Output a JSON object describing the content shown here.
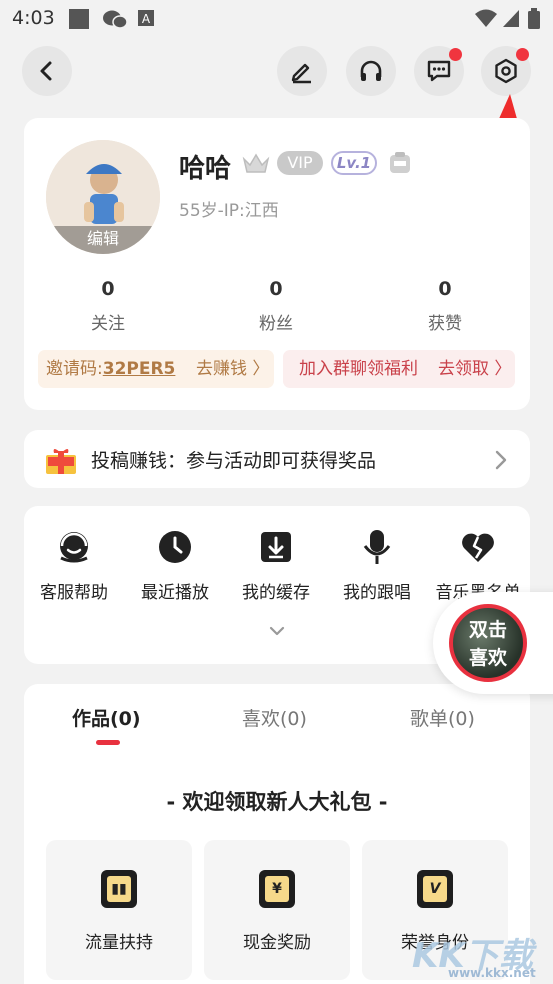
{
  "status_bar": {
    "time": "4:03"
  },
  "profile": {
    "username": "哈哈",
    "vip_label": "VIP",
    "level_label": "Lv.1",
    "avatar_edit_label": "编辑",
    "meta": "55岁-IP:江西",
    "stats": [
      {
        "value": "0",
        "label": "关注"
      },
      {
        "value": "0",
        "label": "粉丝"
      },
      {
        "value": "0",
        "label": "获赞"
      }
    ],
    "invite": {
      "prefix": "邀请码:",
      "code": "32PER5",
      "action": "去赚钱 〉"
    },
    "group": {
      "text": "加入群聊领福利",
      "action": "去领取 〉"
    }
  },
  "banner": {
    "text": "投稿赚钱：参与活动即可获得奖品"
  },
  "tools": [
    {
      "label": "客服帮助",
      "icon": "headset-icon"
    },
    {
      "label": "最近播放",
      "icon": "clock-icon"
    },
    {
      "label": "我的缓存",
      "icon": "download-icon"
    },
    {
      "label": "我的跟唱",
      "icon": "microphone-icon"
    },
    {
      "label": "音乐黑名单",
      "icon": "broken-heart-icon"
    }
  ],
  "tabs": [
    {
      "label": "作品(0)",
      "active": true
    },
    {
      "label": "喜欢(0)",
      "active": false
    },
    {
      "label": "歌单(0)",
      "active": false
    }
  ],
  "gift": {
    "title": "- 欢迎领取新人大礼包 -",
    "items": [
      {
        "label": "流量扶持",
        "glyph": "▮▮",
        "icon": "chart-icon"
      },
      {
        "label": "现金奖励",
        "glyph": "¥",
        "icon": "cash-icon"
      },
      {
        "label": "荣誉身份",
        "glyph": "V",
        "icon": "v-badge-icon"
      }
    ]
  },
  "float_button": {
    "line1": "双击",
    "line2": "喜欢"
  },
  "watermark": {
    "text": "KK下载",
    "url": "www.kkx.net"
  },
  "colors": {
    "accent": "#e8313f",
    "notify_dot": "#f0353f",
    "invite": "#b07a45",
    "group": "#c9414a"
  }
}
